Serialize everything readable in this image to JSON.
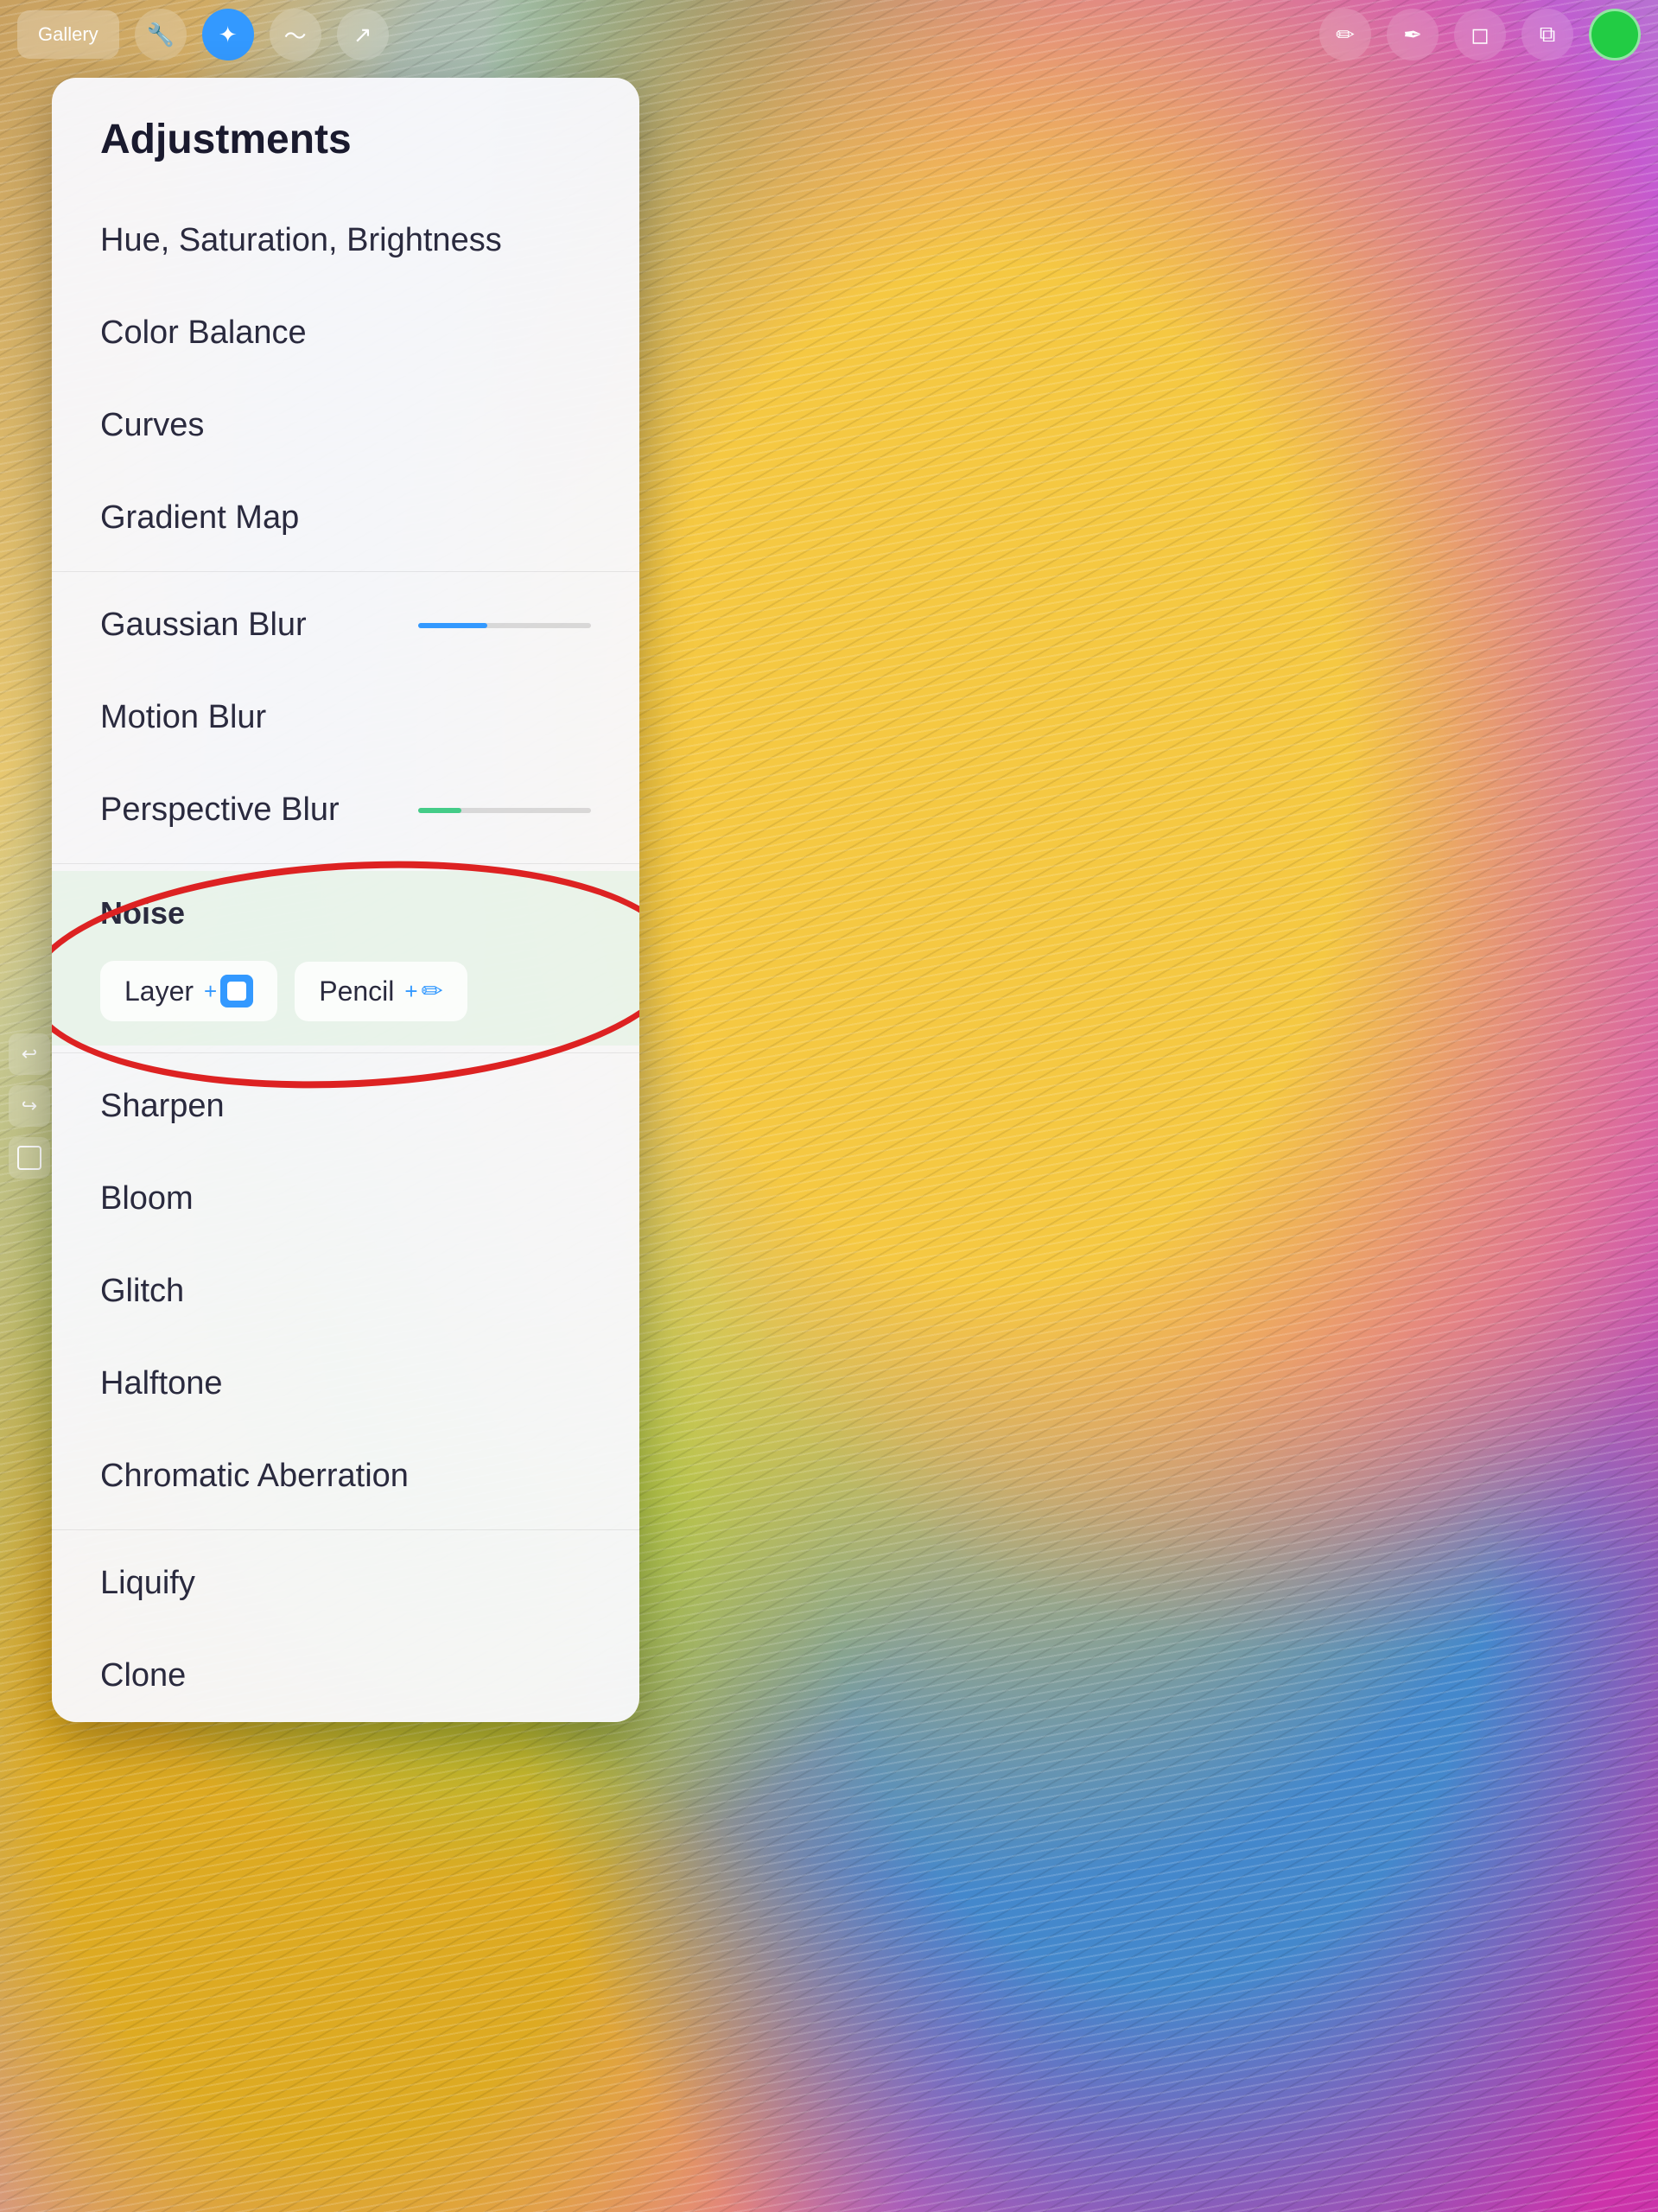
{
  "toolbar": {
    "gallery_label": "Gallery",
    "tools": {
      "wrench": "⚙",
      "active": "✦",
      "smudge": "S",
      "arrow": "↗",
      "brush": "✏",
      "pen": "✒",
      "eraser": "◻",
      "layers": "⧉",
      "color": ""
    }
  },
  "panel": {
    "title": "Adjustments",
    "items": [
      {
        "id": "hue-sat",
        "label": "Hue, Saturation, Brightness",
        "divider_after": false
      },
      {
        "id": "color-balance",
        "label": "Color Balance",
        "divider_after": false
      },
      {
        "id": "curves",
        "label": "Curves",
        "divider_after": false
      },
      {
        "id": "gradient-map",
        "label": "Gradient Map",
        "divider_after": true
      },
      {
        "id": "gaussian-blur",
        "label": "Gaussian Blur",
        "divider_after": false
      },
      {
        "id": "motion-blur",
        "label": "Motion Blur",
        "divider_after": false
      },
      {
        "id": "perspective-blur",
        "label": "Perspective Blur",
        "divider_after": false
      }
    ],
    "noise_section": {
      "label": "Noise",
      "layer_btn": "Layer",
      "pencil_btn": "Pencil"
    },
    "items_after_noise": [
      {
        "id": "sharpen",
        "label": "Sharpen",
        "divider_after": false
      },
      {
        "id": "bloom",
        "label": "Bloom",
        "divider_after": false
      },
      {
        "id": "glitch",
        "label": "Glitch",
        "divider_after": false
      },
      {
        "id": "halftone",
        "label": "Halftone",
        "divider_after": false
      },
      {
        "id": "chromatic",
        "label": "Chromatic Aberration",
        "divider_after": true
      },
      {
        "id": "liquify",
        "label": "Liquify",
        "divider_after": false
      },
      {
        "id": "clone",
        "label": "Clone",
        "divider_after": false
      }
    ]
  }
}
